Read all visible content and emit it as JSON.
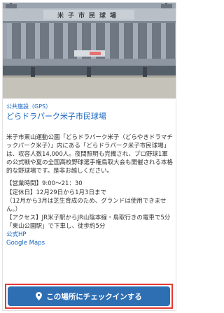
{
  "spot": {
    "category": "公共施設（GPS）",
    "title": "どらドラパーク米子市民球場",
    "stadium_sign": "米子市民球場",
    "description": "米子市東山運動公園「どらドラパーク米子（どらやきドラマチックパーク米子）」内にある「どらドラパーク米子市民球場」は、収容人数14,000人。夜間照明も完備され、プロ野球1軍の公式戦や夏の全国高校野球選手権鳥取大会も開催される本格的な野球場です。是非お越しください。",
    "hours": "【営業時間】9:00～21：30",
    "closed": "【定休日】12月29日から1月3日まで",
    "closed_note": "（12月から3月は芝生育成のため、グランドは使用できません。）",
    "access": "【アクセス】JR米子駅からJR山陰本線・鳥取行きの電車で5分「東山公園駅」で下車し、徒歩約5分",
    "link_official": "公式HP",
    "link_map": "Google Maps"
  },
  "checkin": {
    "label": "この場所にチェックインする",
    "icon": "map-pin-icon",
    "button_color": "#2e6fb4",
    "highlight_color": "#e53935"
  },
  "colors": {
    "link": "#1565c0",
    "text": "#333333"
  }
}
